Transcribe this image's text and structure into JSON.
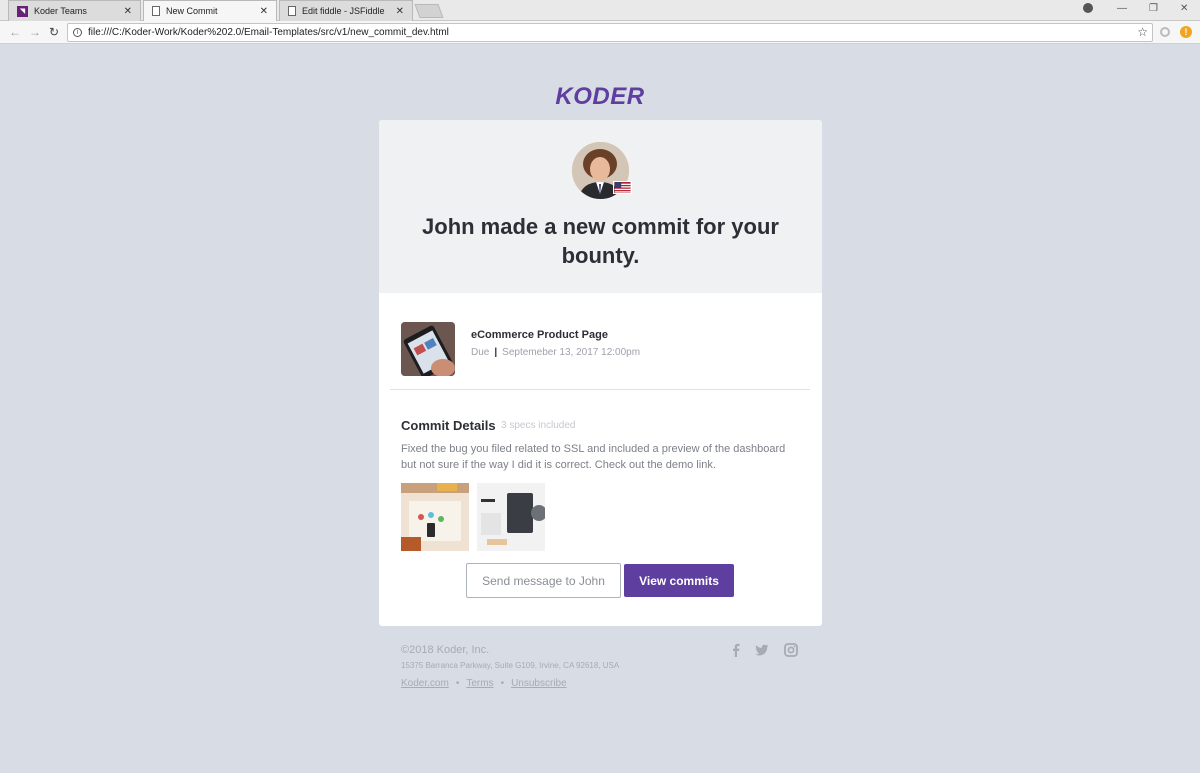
{
  "browser": {
    "tabs": [
      {
        "label": "Koder Teams",
        "active": false
      },
      {
        "label": "New Commit",
        "active": true
      },
      {
        "label": "Edit fiddle - JSFiddle",
        "active": false
      }
    ],
    "url": "file:///C:/Koder-Work/Koder%202.0/Email-Templates/src/v1/new_commit_dev.html"
  },
  "email": {
    "logo_text": "KODER",
    "headline": "John made a new commit for your bounty.",
    "project": {
      "title": "eCommerce Product Page",
      "due_label": "Due",
      "due_date": "Septemeber 13, 2017 12:00pm"
    },
    "commit": {
      "section_title": "Commit Details",
      "specs": "3 specs included",
      "description": "Fixed the bug you filed related to SSL and included a preview of the dashboard but not sure if the way I did it is correct. Check out the demo link."
    },
    "buttons": {
      "message": "Send message to John",
      "view": "View commits"
    },
    "footer": {
      "copyright": "©2018 Koder, Inc.",
      "address": "15375 Barranca Parkway, Suite G109, Irvine, CA 92618, USA",
      "links": [
        "Koder.com",
        "Terms",
        "Unsubscribe"
      ],
      "social_icons": [
        "facebook-icon",
        "twitter-icon",
        "instagram-icon"
      ]
    },
    "colors": {
      "brand": "#5e3fa0",
      "background": "#d8dce4"
    }
  }
}
